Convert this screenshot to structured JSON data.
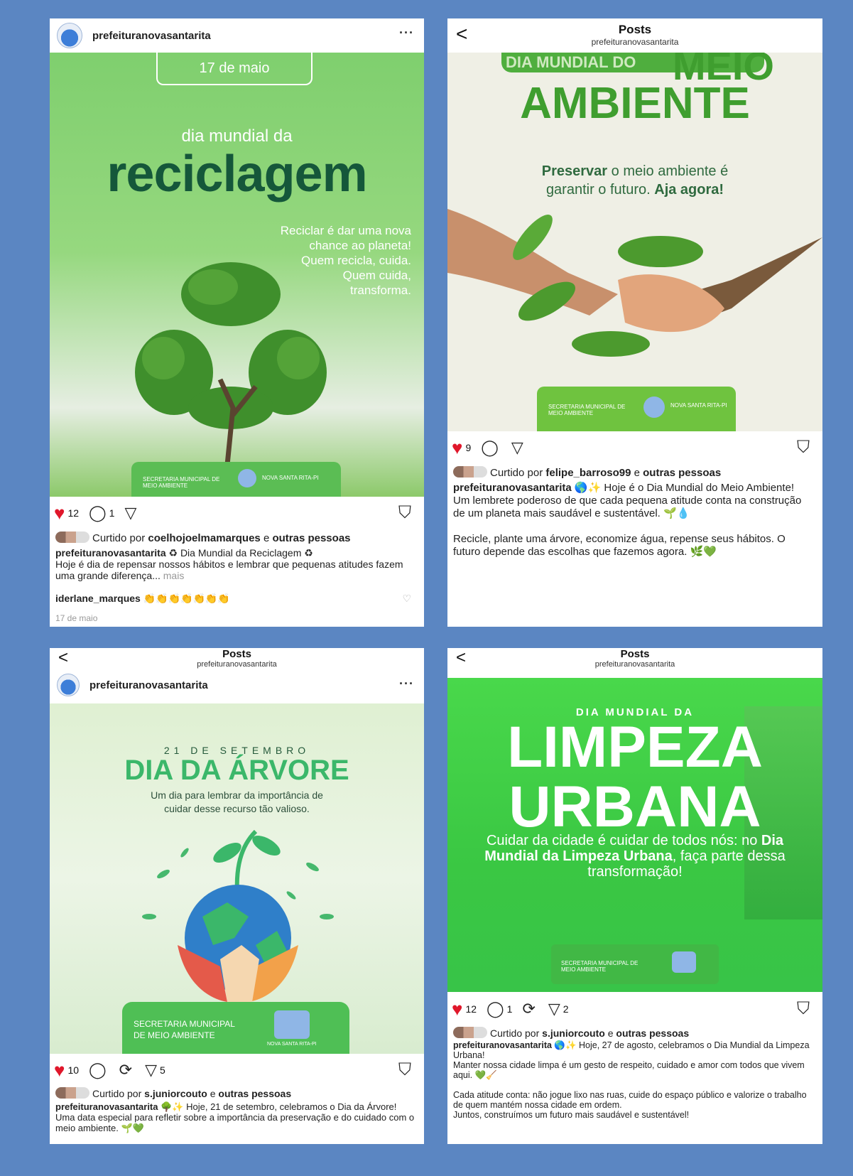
{
  "colors": {
    "background": "#5b86c2",
    "heart": "#e0172b"
  },
  "p1": {
    "username": "prefeituranovasantarita",
    "more": "···",
    "date": "17 de maio",
    "subtitle": "dia mundial da",
    "title": "reciclagem",
    "text_lines": [
      "Reciclar é dar uma nova",
      "chance ao planeta!",
      "Quem recicla, cuida.",
      "Quem cuida,",
      "transforma."
    ],
    "footer_left": "SECRETARIA MUNICIPAL DE MEIO AMBIENTE",
    "footer_right": "NOVA SANTA RITA-PI",
    "likes": "12",
    "comments": "1",
    "liked_prefix": "Curtido por",
    "liked_user": "coelhojoelmamarques",
    "liked_mid": "e",
    "liked_others": "outras pessoas",
    "caption_user": "prefeituranovasantarita",
    "caption_text": "♻ Dia Mundial da Reciclagem ♻",
    "caption_body": "Hoje é dia de repensar nossos hábitos e lembrar que pequenas atitudes fazem uma grande diferença...",
    "more_label": "mais",
    "comment_user": "iderlane_marques",
    "comment_text": "👏👏👏👏👏👏👏",
    "timestamp": "17 de maio"
  },
  "p2": {
    "header_title": "Posts",
    "header_sub": "prefeituranovasantarita",
    "top_label": "DIA MUNDIAL DO",
    "meio": "MEIO",
    "title": "AMBIENTE",
    "text_bold1": "Preservar",
    "text_rest1": " o meio ambiente é",
    "text_line2": "garantir o futuro.",
    "text_bold2": "Aja agora!",
    "footer_left": "SECRETARIA MUNICIPAL DE MEIO AMBIENTE",
    "footer_right": "NOVA SANTA RITA-PI",
    "likes": "9",
    "liked_prefix": "Curtido por",
    "liked_user": "felipe_barroso99",
    "liked_mid": "e",
    "liked_others": "outras pessoas",
    "caption_user": "prefeituranovasantarita",
    "caption_text": "🌎✨ Hoje é o Dia Mundial do Meio Ambiente!",
    "caption_body": "Um lembrete poderoso de que cada pequena atitude conta na construção de um planeta mais saudável e sustentável. 🌱💧",
    "caption_body2": "Recicle, plante uma árvore, economize água, repense seus hábitos. O futuro depende das escolhas que fazemos agora. 🌿💚"
  },
  "p3": {
    "header_title": "Posts",
    "header_sub": "prefeituranovasantarita",
    "username": "prefeituranovasantarita",
    "more": "···",
    "date": "21 DE SETEMBRO",
    "title": "DIA DA ÁRVORE",
    "subtitle_l1": "Um dia para lembrar da importância de",
    "subtitle_l2": "cuidar desse recurso tão valioso.",
    "footer_left1": "SECRETARIA MUNICIPAL",
    "footer_left2": "DE MEIO AMBIENTE",
    "footer_right": "NOVA SANTA RITA-PI",
    "likes": "10",
    "shares": "5",
    "liked_prefix": "Curtido por",
    "liked_user": "s.juniorcouto",
    "liked_mid": "e",
    "liked_others": "outras pessoas",
    "caption_user": "prefeituranovasantarita",
    "caption_text": "🌳✨ Hoje, 21 de setembro, celebramos o Dia da Árvore! Uma data especial para refletir sobre a importância da preservação e do cuidado com o meio ambiente. 🌱💚"
  },
  "p4": {
    "header_title": "Posts",
    "header_sub": "prefeituranovasantarita",
    "top_label": "DIA MUNDIAL DA",
    "title_l1": "LIMPEZA",
    "title_l2": "URBANA",
    "text_a": "Cuidar da cidade é cuidar de todos nós: no ",
    "text_b": "Dia Mundial da Limpeza Urbana",
    "text_c": ", faça parte dessa transformação!",
    "footer_left": "SECRETARIA MUNICIPAL DE MEIO AMBIENTE",
    "likes": "12",
    "comments": "1",
    "shares": "2",
    "liked_prefix": "Curtido por",
    "liked_user": "s.juniorcouto",
    "liked_mid": "e",
    "liked_others": "outras pessoas",
    "caption_user": "prefeituranovasantarita",
    "caption_text": "🌎✨ Hoje, 27 de agosto, celebramos o Dia Mundial da Limpeza Urbana!",
    "caption_body": "Manter nossa cidade limpa é um gesto de respeito, cuidado e amor com todos que vivem aqui. 💚🧹",
    "caption_body2": "Cada atitude conta: não jogue lixo nas ruas, cuide do espaço público e valorize o trabalho de quem mantém nossa cidade em ordem.",
    "caption_body3": "Juntos, construímos um futuro mais saudável e sustentável!"
  }
}
